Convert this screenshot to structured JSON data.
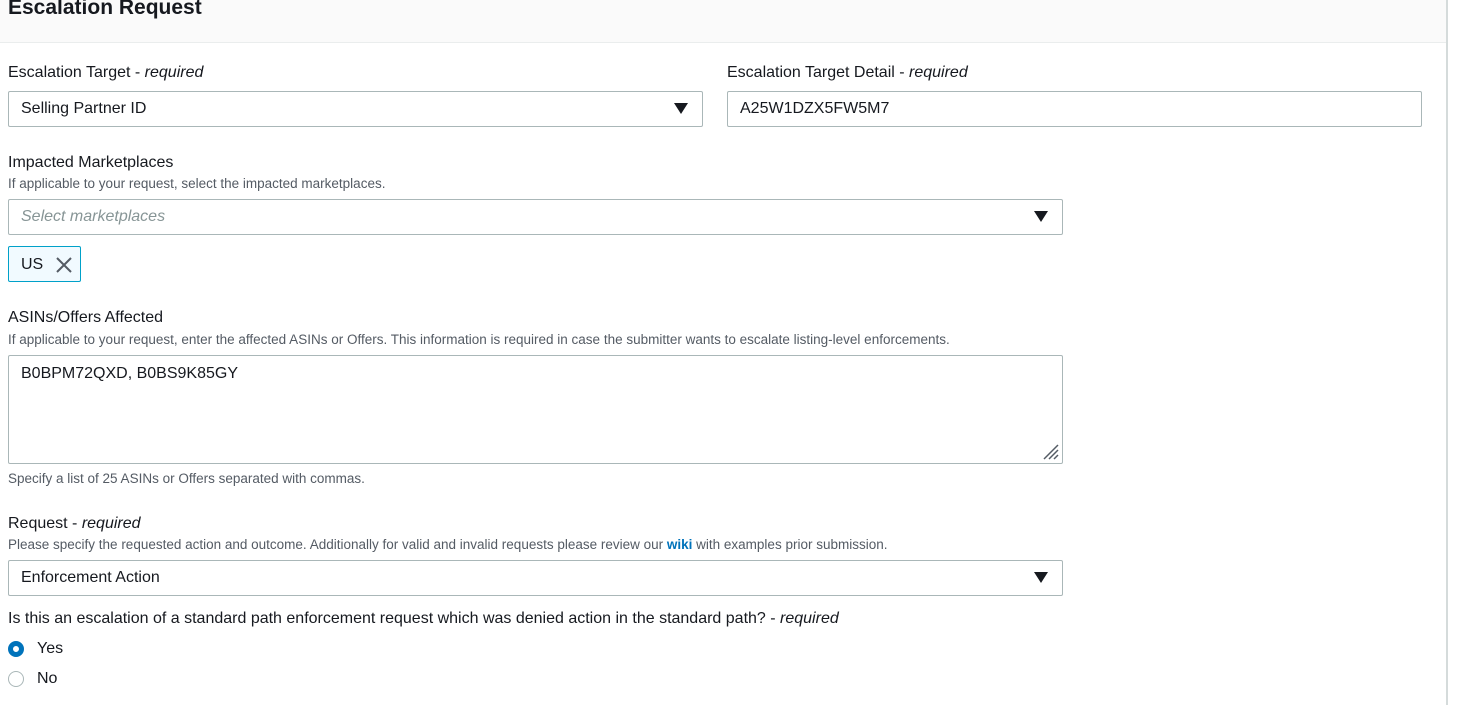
{
  "header": {
    "title": "Escalation Request"
  },
  "escalation_target": {
    "label": "Escalation Target",
    "required_suffix": "required",
    "selected_value": "Selling Partner ID"
  },
  "escalation_target_detail": {
    "label": "Escalation Target Detail",
    "required_suffix": "required",
    "value": "A25W1DZX5FW5M7"
  },
  "impacted_marketplaces": {
    "label": "Impacted Marketplaces",
    "description": "If applicable to your request, select the impacted marketplaces.",
    "placeholder": "Select marketplaces",
    "tokens": [
      {
        "label": "US"
      }
    ]
  },
  "asins": {
    "label": "ASINs/Offers Affected",
    "description": "If applicable to your request, enter the affected ASINs or Offers. This information is required in case the submitter wants to escalate listing-level enforcements.",
    "value": "B0BPM72QXD, B0BS9K85GY",
    "constraint": "Specify a list of 25 ASINs or Offers separated with commas."
  },
  "request": {
    "label": "Request",
    "required_suffix": "required",
    "description_before": "Please specify the requested action and outcome. Additionally for valid and invalid requests please review our ",
    "link_text": "wiki",
    "description_after": " with examples prior submission.",
    "selected_value": "Enforcement Action"
  },
  "escalation_question": {
    "label": "Is this an escalation of a standard path enforcement request which was denied action in the standard path?",
    "required_suffix": "required",
    "options": [
      {
        "label": "Yes",
        "checked": true
      },
      {
        "label": "No",
        "checked": false
      }
    ]
  },
  "icons": {
    "dropdown": "caret-down-icon",
    "remove_token": "close-icon",
    "resize": "resize-handle-icon"
  },
  "colors": {
    "accent": "#0073bb",
    "token_border": "#00a1c9",
    "token_background": "#f1faff",
    "border": "#aab7b8",
    "description_text": "#545b64"
  }
}
